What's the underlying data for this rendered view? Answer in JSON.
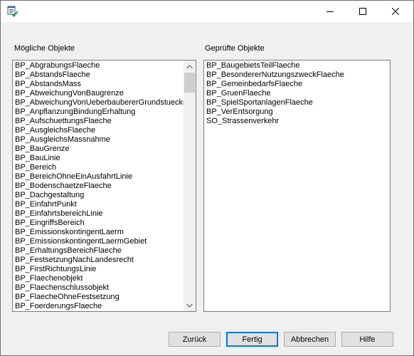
{
  "window": {
    "title_buttons": {
      "minimize": "minimize-icon",
      "maximize": "maximize-icon",
      "close": "close-icon"
    }
  },
  "possible": {
    "label": "Mögliche Objekte",
    "items": [
      "BP_AbgrabungsFlaeche",
      "BP_AbstandsFlaeche",
      "BP_AbstandsMass",
      "BP_AbweichungVonBaugrenze",
      "BP_AbweichungVonUeberbaubererGrundstuecks",
      "BP_AnpflanzungBindungErhaltung",
      "BP_AufschuettungsFlaeche",
      "BP_AusgleichsFlaeche",
      "BP_AusgleichsMassnahme",
      "BP_BauGrenze",
      "BP_BauLinie",
      "BP_Bereich",
      "BP_BereichOhneEinAusfahrtLinie",
      "BP_BodenschaetzeFlaeche",
      "BP_Dachgestaltung",
      "BP_EinfahrtPunkt",
      "BP_EinfahrtsbereichLinie",
      "BP_EingriffsBereich",
      "BP_EmissionskontingentLaerm",
      "BP_EmissionskontingentLaermGebiet",
      "BP_ErhaltungsBereichFlaeche",
      "BP_FestsetzungNachLandesrecht",
      "BP_FirstRichtungsLinie",
      "BP_Flaechenobjekt",
      "BP_Flaechenschlussobjekt",
      "BP_FlaecheOhneFestsetzung",
      "BP_FoerderungsFlaeche"
    ]
  },
  "checked": {
    "label": "Geprüfte Objekte",
    "items": [
      "BP_BaugebietsTeilFlaeche",
      "BP_BesondererNutzungszweckFlaeche",
      "BP_GemeinbedarfsFlaeche",
      "BP_GruenFlaeche",
      "BP_SpielSportanlagenFlaeche",
      "BP_VerEntsorgung",
      "SO_Strassenverkehr"
    ]
  },
  "buttons": {
    "back": "Zurück",
    "finish": "Fertig",
    "cancel": "Abbrechen",
    "help": "Hilfe"
  }
}
